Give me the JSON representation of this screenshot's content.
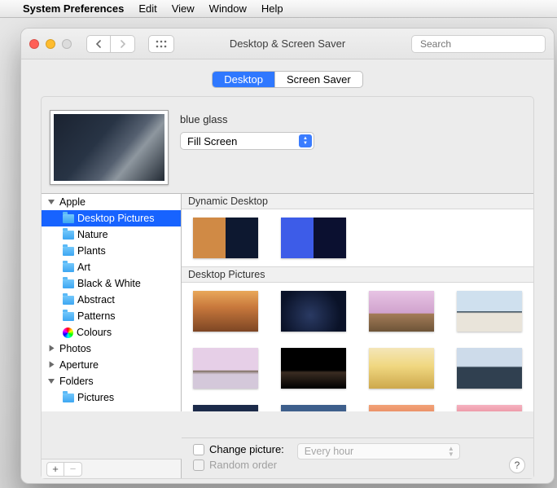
{
  "menubar": {
    "appname": "System Preferences",
    "items": [
      "Edit",
      "View",
      "Window",
      "Help"
    ]
  },
  "window": {
    "title": "Desktop & Screen Saver",
    "search_placeholder": "Search"
  },
  "tabs": {
    "desktop": "Desktop",
    "screensaver": "Screen Saver"
  },
  "preview": {
    "name": "blue glass",
    "fit_mode": "Fill Screen"
  },
  "tree": {
    "apple": "Apple",
    "desktop_pictures": "Desktop Pictures",
    "nature": "Nature",
    "plants": "Plants",
    "art": "Art",
    "black_white": "Black & White",
    "abstract": "Abstract",
    "patterns": "Patterns",
    "colours": "Colours",
    "photos": "Photos",
    "aperture": "Aperture",
    "folders": "Folders",
    "pictures": "Pictures"
  },
  "sections": {
    "dynamic": "Dynamic Desktop",
    "desktop_pics": "Desktop Pictures"
  },
  "options": {
    "change_picture": "Change picture:",
    "random_order": "Random order",
    "interval": "Every hour"
  },
  "help": "?"
}
